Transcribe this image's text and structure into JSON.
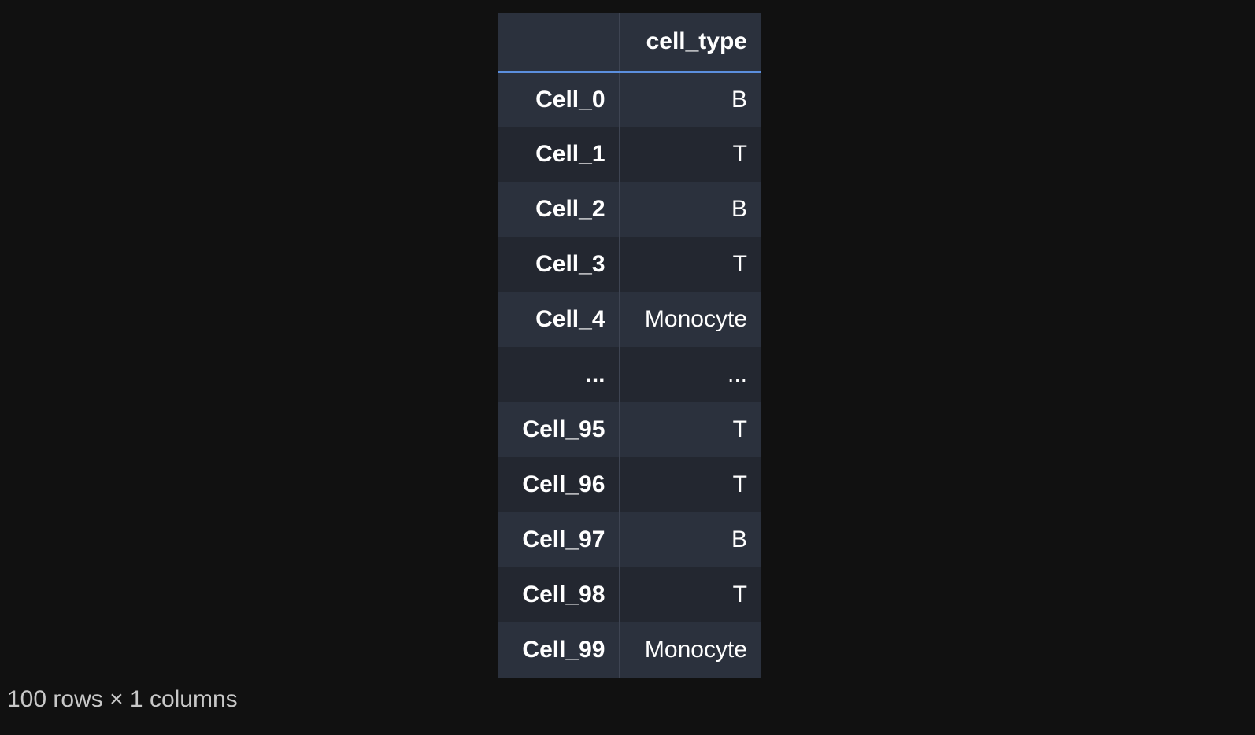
{
  "table": {
    "index_header": "",
    "columns": [
      "cell_type"
    ],
    "rows": [
      {
        "index": "Cell_0",
        "cell_type": "B"
      },
      {
        "index": "Cell_1",
        "cell_type": "T"
      },
      {
        "index": "Cell_2",
        "cell_type": "B"
      },
      {
        "index": "Cell_3",
        "cell_type": "T"
      },
      {
        "index": "Cell_4",
        "cell_type": "Monocyte"
      },
      {
        "index": "...",
        "cell_type": "..."
      },
      {
        "index": "Cell_95",
        "cell_type": "T"
      },
      {
        "index": "Cell_96",
        "cell_type": "T"
      },
      {
        "index": "Cell_97",
        "cell_type": "B"
      },
      {
        "index": "Cell_98",
        "cell_type": "T"
      },
      {
        "index": "Cell_99",
        "cell_type": "Monocyte"
      }
    ]
  },
  "shape_text": "100 rows × 1 columns",
  "colors": {
    "background": "#111111",
    "header_bg": "#2b313d",
    "row_odd_bg": "#2b313d",
    "row_even_bg": "#232730",
    "header_rule": "#5b8fde",
    "text": "#ffffff",
    "shape_text": "#c8c8c8"
  }
}
